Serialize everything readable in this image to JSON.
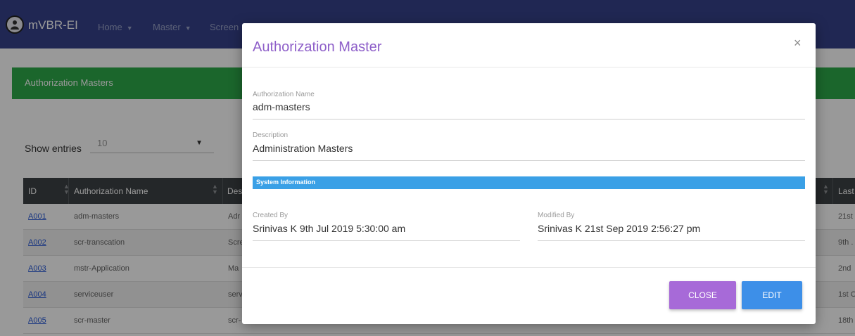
{
  "navbar": {
    "title": "mVBR-EI",
    "items": [
      {
        "label": "Home"
      },
      {
        "label": "Master"
      },
      {
        "label": "Screen"
      }
    ]
  },
  "panel": {
    "title": "Authorization Masters"
  },
  "entries": {
    "label": "Show entries",
    "value": "10"
  },
  "table": {
    "headers": {
      "id": "ID",
      "name": "Authorization Name",
      "desc": "Des",
      "last": "Last"
    },
    "rows": [
      {
        "id": "A001",
        "name": "adm-masters",
        "desc": "Adr",
        "last": "21st"
      },
      {
        "id": "A002",
        "name": "scr-transcation",
        "desc": "Scre",
        "last": "9th ."
      },
      {
        "id": "A003",
        "name": "mstr-Application",
        "desc": "Ma",
        "last": "2nd"
      },
      {
        "id": "A004",
        "name": "serviceuser",
        "desc": "serv",
        "last": "1st C"
      },
      {
        "id": "A005",
        "name": "scr-master",
        "desc": "scr-",
        "last": "18th"
      }
    ]
  },
  "modal": {
    "title": "Authorization Master",
    "close_icon": "×",
    "auth_name": {
      "label": "Authorization Name",
      "value": "adm-masters"
    },
    "description": {
      "label": "Description",
      "value": "Administration Masters"
    },
    "system_info": "System Information",
    "created_by": {
      "label": "Created By",
      "value": "Srinivas K  9th Jul 2019 5:30:00 am"
    },
    "modified_by": {
      "label": "Modified By",
      "value": "Srinivas K  21st Sep 2019 2:56:27 pm"
    },
    "buttons": {
      "close": "CLOSE",
      "edit": "EDIT"
    }
  },
  "colors": {
    "navbar": "#36418a",
    "panel_header": "#2eaa4a",
    "modal_title": "#8e5fc9",
    "close_button": "#a76ad8",
    "edit_button": "#3d8fe8",
    "system_info_bar": "#3aa0e6"
  }
}
